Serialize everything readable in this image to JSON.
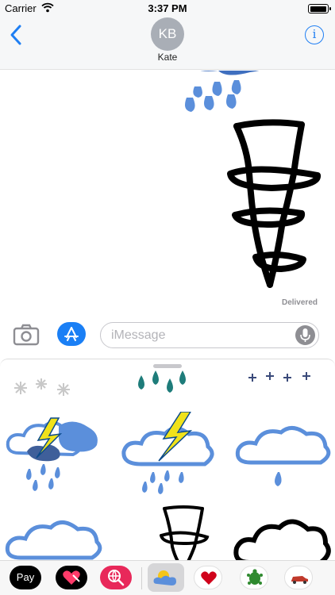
{
  "status_bar": {
    "carrier": "Carrier",
    "time": "3:37 PM",
    "battery_level": 0.9
  },
  "header": {
    "avatar_initials": "KB",
    "contact_name": "Kate",
    "info_label": "i"
  },
  "conversation": {
    "delivered_label": "Delivered"
  },
  "input_bar": {
    "placeholder": "iMessage"
  },
  "drawer": {
    "stickers": [
      "cloud-rain-lightning-sticker",
      "cloud-rain-lightning-outline-sticker",
      "cloud-rain-sticker",
      "cloud-outline-sticker",
      "tornado-sticker",
      "black-cloud-sticker"
    ]
  },
  "app_strip": {
    "apple_pay_label": "Pay",
    "apps": [
      "apple-pay-icon",
      "digital-touch-icon",
      "web-search-icon",
      "weather-stickers-icon",
      "heart-sticker-icon",
      "turtle-sticker-icon",
      "car-sticker-icon"
    ]
  },
  "colors": {
    "accent": "#1f7ff3",
    "sticker_blue": "#5b8fdb",
    "lightning": "#f0e21a"
  }
}
